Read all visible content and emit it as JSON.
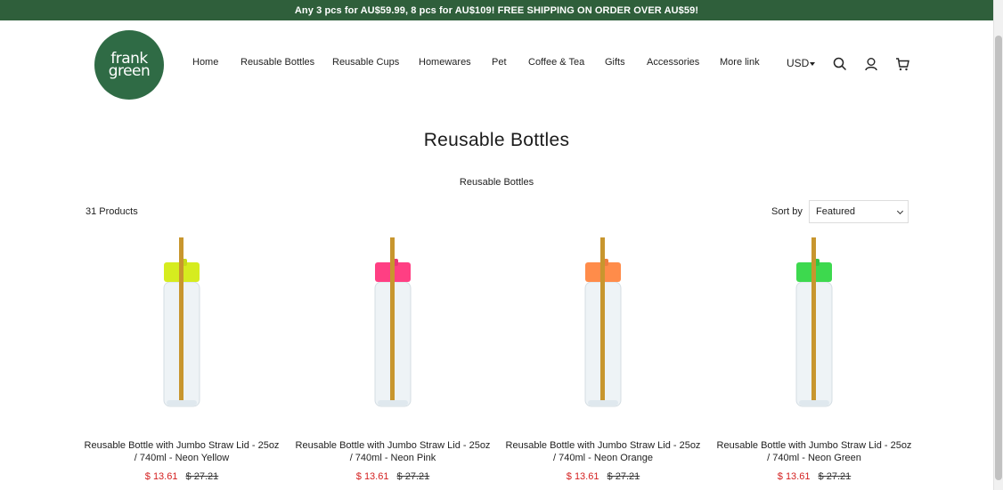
{
  "announcement": "Any 3 pcs for AU$59.99, 8 pcs for AU$109! FREE SHIPPING ON ORDER OVER AU$59!",
  "logo": {
    "line1": "frank",
    "line2": "green"
  },
  "nav": [
    "Home",
    "Reusable Bottles",
    "Reusable Cups",
    "Homewares",
    "Pet",
    "Coffee & Tea",
    "Gifts",
    "Accessories",
    "More link"
  ],
  "currency": "USD",
  "icons": {
    "search": "search-icon",
    "account": "user-icon",
    "cart": "cart-icon"
  },
  "page": {
    "title": "Reusable Bottles",
    "breadcrumb": "Reusable Bottles"
  },
  "toolbar": {
    "count": "31 Products",
    "sort_label": "Sort by",
    "sort_value": "Featured"
  },
  "products": [
    {
      "title": "Reusable Bottle with Jumbo Straw Lid - 25oz / 740ml - Neon Yellow",
      "sale": "$ 13.61",
      "orig": "$ 27.21",
      "color": "#d6ec1f"
    },
    {
      "title": "Reusable Bottle with Jumbo Straw Lid - 25oz / 740ml - Neon Pink",
      "sale": "$ 13.61",
      "orig": "$ 27.21",
      "color": "#ff3f83"
    },
    {
      "title": "Reusable Bottle with Jumbo Straw Lid - 25oz / 740ml - Neon Orange",
      "sale": "$ 13.61",
      "orig": "$ 27.21",
      "color": "#ff8c4a"
    },
    {
      "title": "Reusable Bottle with Jumbo Straw Lid - 25oz / 740ml - Neon Green",
      "sale": "$ 13.61",
      "orig": "$ 27.21",
      "color": "#3dd94e"
    }
  ],
  "colors": {
    "announcement_bg": "#2f5f3b",
    "logo_bg": "#2f6b45",
    "sale": "#d41f1f",
    "straw": "#c8962e"
  }
}
